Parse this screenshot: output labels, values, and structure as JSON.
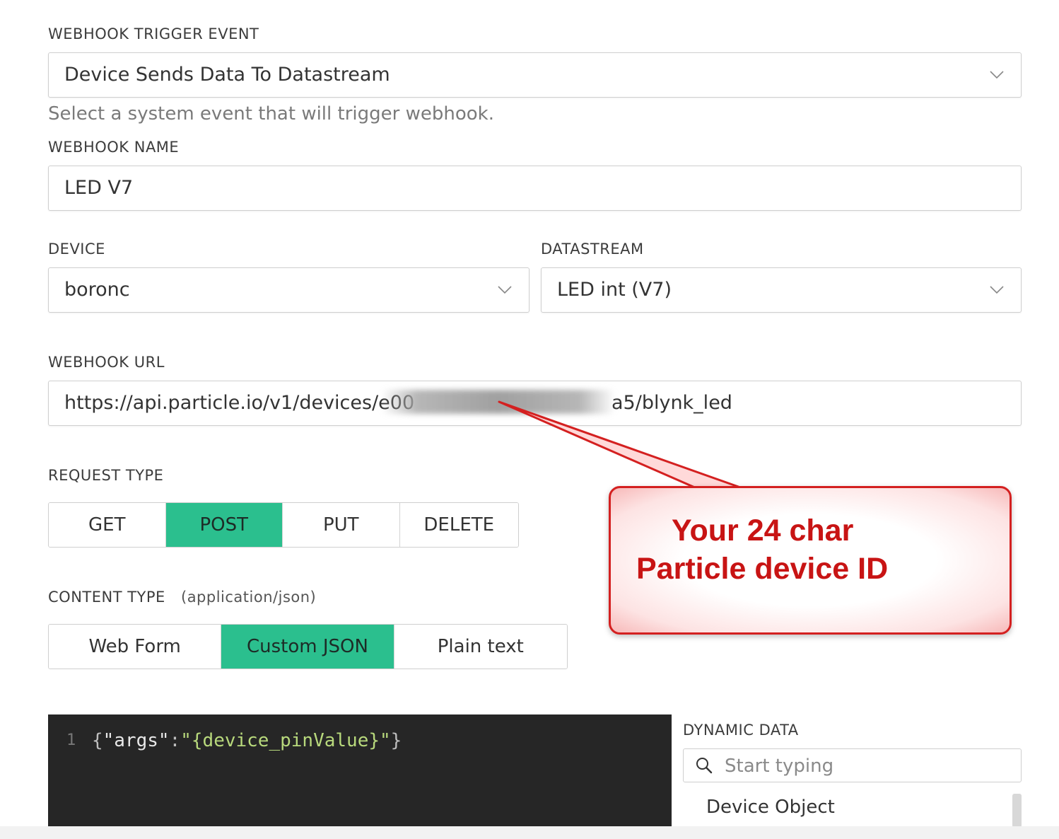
{
  "trigger_event": {
    "label": "WEBHOOK TRIGGER EVENT",
    "value": "Device Sends Data To Datastream",
    "hint": "Select a system event that will trigger webhook."
  },
  "webhook_name": {
    "label": "WEBHOOK NAME",
    "value": "LED V7"
  },
  "device": {
    "label": "DEVICE",
    "value": "boronc"
  },
  "datastream": {
    "label": "DATASTREAM",
    "value": "LED int (V7)"
  },
  "webhook_url": {
    "label": "WEBHOOK URL",
    "value_prefix": "https://api.particle.io/v1/devices/e00",
    "value_suffix": "a5/blynk_led"
  },
  "request_type": {
    "label": "REQUEST TYPE",
    "options": [
      "GET",
      "POST",
      "PUT",
      "DELETE"
    ],
    "selected": "POST"
  },
  "content_type": {
    "label": "CONTENT TYPE",
    "sublabel": "(application/json)",
    "options": [
      "Web Form",
      "Custom JSON",
      "Plain text"
    ],
    "selected": "Custom JSON"
  },
  "editor": {
    "line_number": "1",
    "key": "\"args\"",
    "value": "\"{device_pinValue}\""
  },
  "dynamic_data": {
    "label": "DYNAMIC DATA",
    "search_placeholder": "Start typing",
    "first_item": "Device Object"
  },
  "callout": {
    "line1": "Your 24 char",
    "line2": "Particle device ID"
  },
  "colors": {
    "accent": "#2bbf8e",
    "callout_red": "#c81414",
    "editor_bg": "#262626"
  }
}
